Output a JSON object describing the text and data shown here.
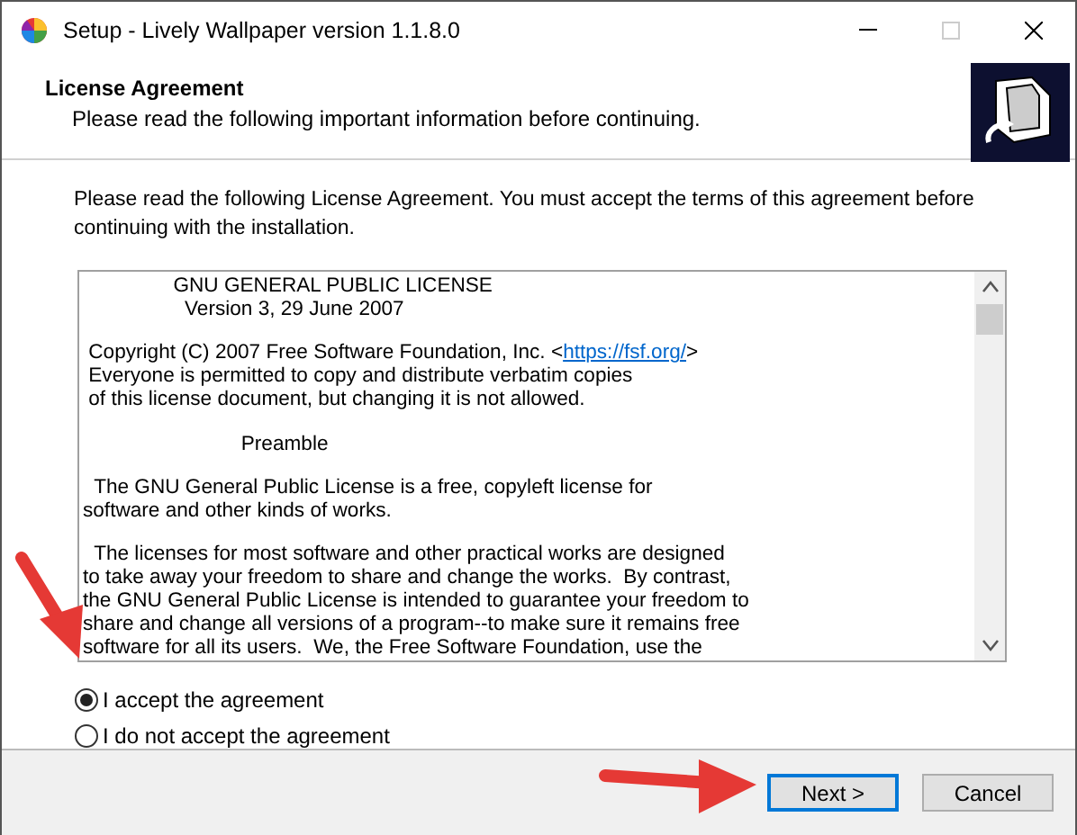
{
  "window": {
    "title": "Setup - Lively Wallpaper version 1.1.8.0"
  },
  "header": {
    "title": "License Agreement",
    "subtitle": "Please read the following important information before continuing."
  },
  "intro": "Please read the following License Agreement. You must accept the terms of this agreement before continuing with the installation.",
  "license_paragraphs": [
    [
      {
        "text": "                GNU GENERAL PUBLIC LICENSE"
      },
      {
        "text": "                  Version 3, 29 June 2007"
      }
    ],
    [
      {
        "text": " Copyright (C) 2007 Free Software Foundation, Inc. <",
        "link": "https://fsf.org/",
        "after": ">"
      },
      {
        "text": " Everyone is permitted to copy and distribute verbatim copies"
      },
      {
        "text": " of this license document, but changing it is not allowed."
      }
    ],
    [
      {
        "text": "                            Preamble"
      }
    ],
    [
      {
        "text": "  The GNU General Public License is a free, copyleft license for"
      },
      {
        "text": "software and other kinds of works."
      }
    ],
    [
      {
        "text": "  The licenses for most software and other practical works are designed"
      },
      {
        "text": "to take away your freedom to share and change the works.  By contrast,"
      },
      {
        "text": "the GNU General Public License is intended to guarantee your freedom to"
      },
      {
        "text": "share and change all versions of a program--to make sure it remains free"
      },
      {
        "text": "software for all its users.  We, the Free Software Foundation, use the"
      }
    ]
  ],
  "options": [
    {
      "label": "I accept the agreement",
      "selected": true
    },
    {
      "label": "I do not accept the agreement",
      "selected": false
    }
  ],
  "buttons": [
    {
      "label": "Next >",
      "kind": "default"
    },
    {
      "label": "Cancel",
      "kind": "normal"
    }
  ]
}
